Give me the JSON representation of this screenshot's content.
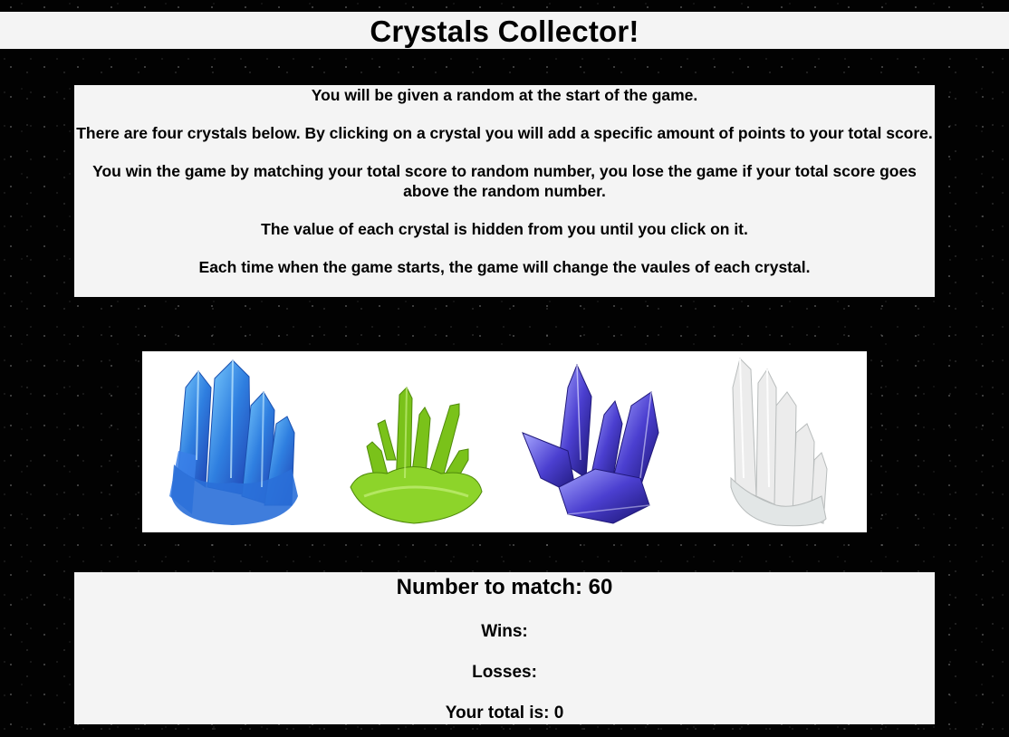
{
  "header": {
    "title": "Crystals Collector!"
  },
  "instructions": [
    "You will be given a random at the start of the game.",
    "There are four crystals below. By clicking on a crystal you will add a specific amount of points to your total score.",
    "You win the game by matching your total score to random number, you lose the game if your total score goes above the random number.",
    "The value of each crystal is hidden from you until you click on it.",
    "Each time when the game starts, the game will change the vaules of each crystal."
  ],
  "crystals": [
    {
      "name": "blue-crystal",
      "color": "#2f7fe0"
    },
    {
      "name": "green-crystal",
      "color": "#7ac21a"
    },
    {
      "name": "purple-crystal",
      "color": "#4b3fd0"
    },
    {
      "name": "clear-crystal",
      "color": "#d8dcdc"
    }
  ],
  "scoreboard": {
    "target_text": "Number to match: 60",
    "wins_text": "Wins:",
    "losses_text": "Losses:",
    "total_text": "Your total is: 0"
  }
}
